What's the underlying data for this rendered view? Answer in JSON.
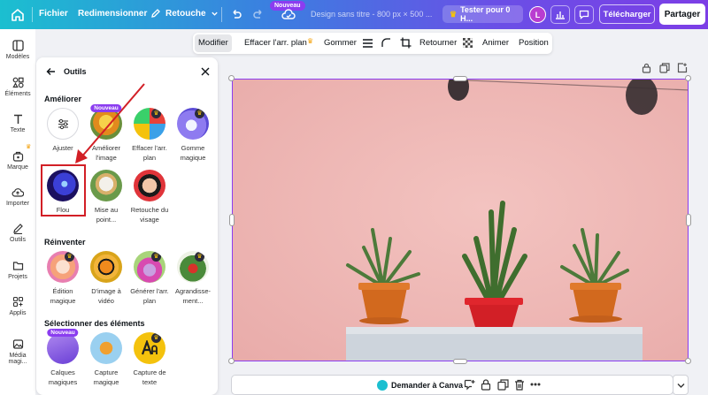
{
  "topbar": {
    "file": "Fichier",
    "resize": "Redimensionner",
    "retouch": "Retouche",
    "new_badge": "Nouveau",
    "design_title": "Design sans titre - 800 px × 500 ...",
    "try_pro": "Tester pour 0 H...",
    "avatar_letter": "L",
    "download": "Télécharger",
    "share": "Partager"
  },
  "rail": {
    "items": [
      {
        "label": "Modèles"
      },
      {
        "label": "Éléments"
      },
      {
        "label": "Texte"
      },
      {
        "label": "Marque"
      },
      {
        "label": "Importer"
      },
      {
        "label": "Outils"
      },
      {
        "label": "Projets"
      },
      {
        "label": "Applis"
      },
      {
        "label": "Média magi..."
      }
    ]
  },
  "context_toolbar": {
    "edit": "Modifier",
    "bg_remover": "Effacer l'arr. plan",
    "erase": "Gommer",
    "flip": "Retourner",
    "animate": "Animer",
    "position": "Position"
  },
  "panel": {
    "title": "Outils",
    "sections": {
      "enhance": "Améliorer",
      "reinvent": "Réinventer",
      "select": "Sélectionner des éléments"
    },
    "enhance_tools": [
      {
        "label": "Ajuster"
      },
      {
        "label": "Améliorer l'image",
        "badge": "Nouveau"
      },
      {
        "label": "Effacer l'arr. plan"
      },
      {
        "label": "Gomme magique"
      },
      {
        "label": "Flou"
      },
      {
        "label": "Mise au point..."
      },
      {
        "label": "Retouche du visage"
      }
    ],
    "reinvent_tools": [
      {
        "label": "Édition magique"
      },
      {
        "label": "D'image à vidéo"
      },
      {
        "label": "Générer l'arr. plan"
      },
      {
        "label": "Agrandisse-ment..."
      }
    ],
    "select_tools": [
      {
        "label": "Calques magiques",
        "badge": "Nouveau"
      },
      {
        "label": "Capture magique"
      },
      {
        "label": "Capture de texte"
      }
    ]
  },
  "bottombar": {
    "ask_canva": "Demander à Canva"
  },
  "colors": {
    "accent_purple": "#8b3df0",
    "highlight_red": "#d21f26",
    "wall_pink": "#efb9b6"
  }
}
